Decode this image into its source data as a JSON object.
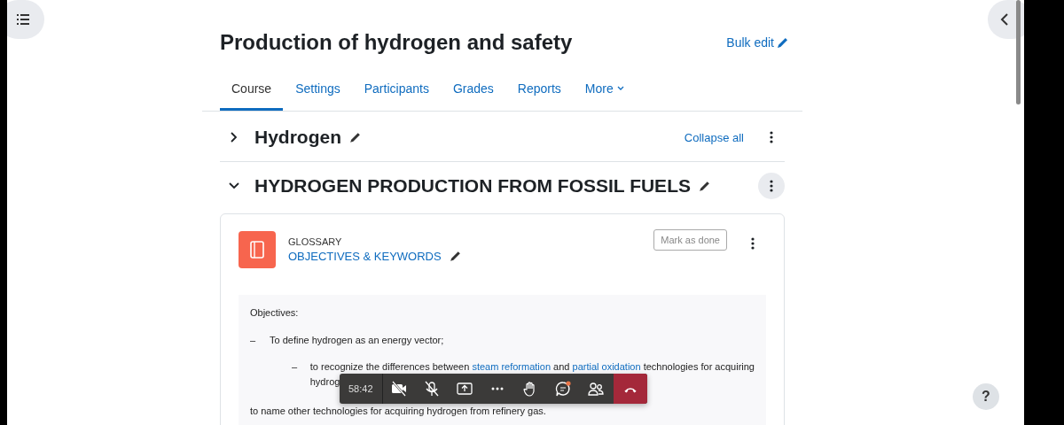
{
  "course_title": "Production of hydrogen and safety",
  "bulk_edit": "Bulk edit",
  "tabs": [
    {
      "label": "Course",
      "selected": true
    },
    {
      "label": "Settings",
      "selected": false
    },
    {
      "label": "Participants",
      "selected": false
    },
    {
      "label": "Grades",
      "selected": false
    },
    {
      "label": "Reports",
      "selected": false
    },
    {
      "label": "More",
      "selected": false,
      "kind": "dropdown"
    }
  ],
  "sections": [
    {
      "title": "Hydrogen",
      "expanded": false,
      "action": "Collapse all"
    },
    {
      "title": "HYDROGEN PRODUCTION FROM FOSSIL FUELS",
      "expanded": true
    }
  ],
  "activity": {
    "type": "GLOSSARY",
    "name": "OBJECTIVES & KEYWORDS",
    "button": "Mark as done",
    "content": {
      "heading": "Objectives:",
      "items": [
        {
          "marker": "–",
          "kind": "plain",
          "parts": [
            {
              "text": "To define hydrogen as an energy vector;",
              "link": false
            }
          ]
        },
        {
          "marker": "–",
          "kind": "nested",
          "parts": [
            {
              "text": "to recognize the differences between ",
              "link": false
            },
            {
              "text": "steam reformation",
              "link": true
            },
            {
              "text": " and ",
              "link": false
            },
            {
              "text": "partial oxidation",
              "link": true
            },
            {
              "text": " technologies for acquiring",
              "link": false
            }
          ],
          "continuation": "hydrog"
        }
      ],
      "closing": "to name other technologies for acquiring hydrogen from refinery gas."
    }
  },
  "call_toolbar": {
    "timer": "58:42",
    "controls": [
      {
        "kind": "camera-off"
      },
      {
        "kind": "mic-off"
      },
      {
        "kind": "share"
      },
      {
        "kind": "more"
      },
      {
        "kind": "hand"
      },
      {
        "kind": "chat",
        "badge": true
      },
      {
        "kind": "people"
      },
      {
        "kind": "hangup"
      }
    ]
  },
  "help": "?"
}
